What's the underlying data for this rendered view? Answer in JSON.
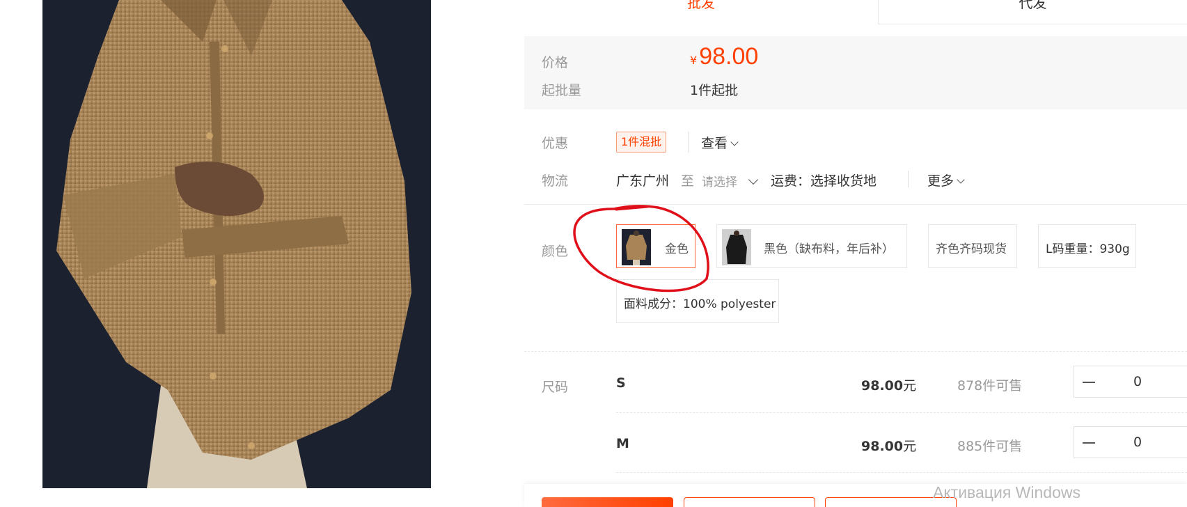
{
  "tabs": {
    "wholesale": "批发",
    "dropship": "代发"
  },
  "price_section": {
    "price_label": "价格",
    "currency_symbol": "¥",
    "price": "98.00",
    "moq_label": "起批量",
    "moq_value": "1件起批"
  },
  "promotion": {
    "label": "优惠",
    "badge": "1件混批",
    "view_link": "查看"
  },
  "logistics": {
    "label": "物流",
    "origin": "广东广州",
    "to": "至",
    "destination_placeholder": "请选择",
    "shipping_fee": "运费：选择收货地",
    "more": "更多"
  },
  "color": {
    "label": "颜色",
    "options": [
      {
        "label": "金色",
        "selected": true,
        "has_thumb": true
      },
      {
        "label": "黑色（缺布料，年后补）",
        "selected": false,
        "has_thumb": true
      },
      {
        "label": "齐色齐码现货",
        "selected": false,
        "has_thumb": false
      },
      {
        "label": "L码重量：930g",
        "selected": false,
        "has_thumb": false
      },
      {
        "label": "面料成分：100% polyester",
        "selected": false,
        "has_thumb": false
      }
    ]
  },
  "size": {
    "label": "尺码",
    "rows": [
      {
        "name": "S",
        "price": "98.00",
        "unit": "元",
        "stock": "878件可售",
        "qty": "0"
      },
      {
        "name": "M",
        "price": "98.00",
        "unit": "元",
        "stock": "885件可售",
        "qty": "0"
      }
    ]
  },
  "watermark": "Активация Windows",
  "colors": {
    "accent": "#ff4000",
    "annotation": "#e0101a",
    "product": "#a88456"
  }
}
